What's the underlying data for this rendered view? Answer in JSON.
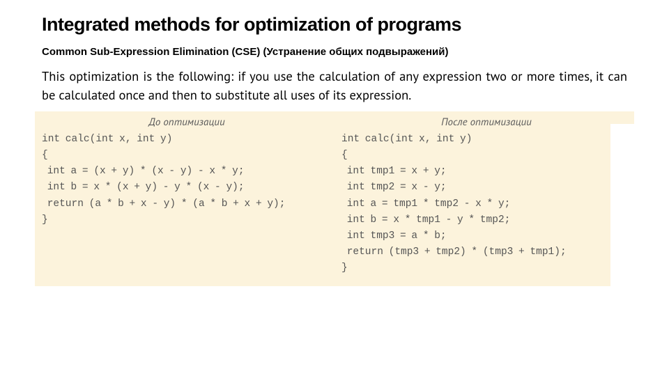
{
  "title": "Integrated methods for optimization of programs",
  "subtitle": "Common Sub-Expression Elimination (CSE) (Устранение общих подвыражений)",
  "body": "This optimization is the following: if you use the calculation of any expression two or more times, it can be calculated once and then to substitute all uses of its expression.",
  "left": {
    "header": "До оптимизации",
    "code": "int calc(int x, int y)\n{\n int a = (x + y) * (x - y) - x * y;\n int b = x * (x + y) - y * (x - y);\n return (a * b + x - y) * (a * b + x + y);\n}"
  },
  "right": {
    "header": "После оптимизации",
    "code": "int calc(int x, int y)\n{\n int tmp1 = x + y;\n int tmp2 = x - y;\n int a = tmp1 * tmp2 - x * y;\n int b = x * tmp1 - y * tmp2;\n int tmp3 = a * b;\n return (tmp3 + tmp2) * (tmp3 + tmp1);\n}"
  }
}
